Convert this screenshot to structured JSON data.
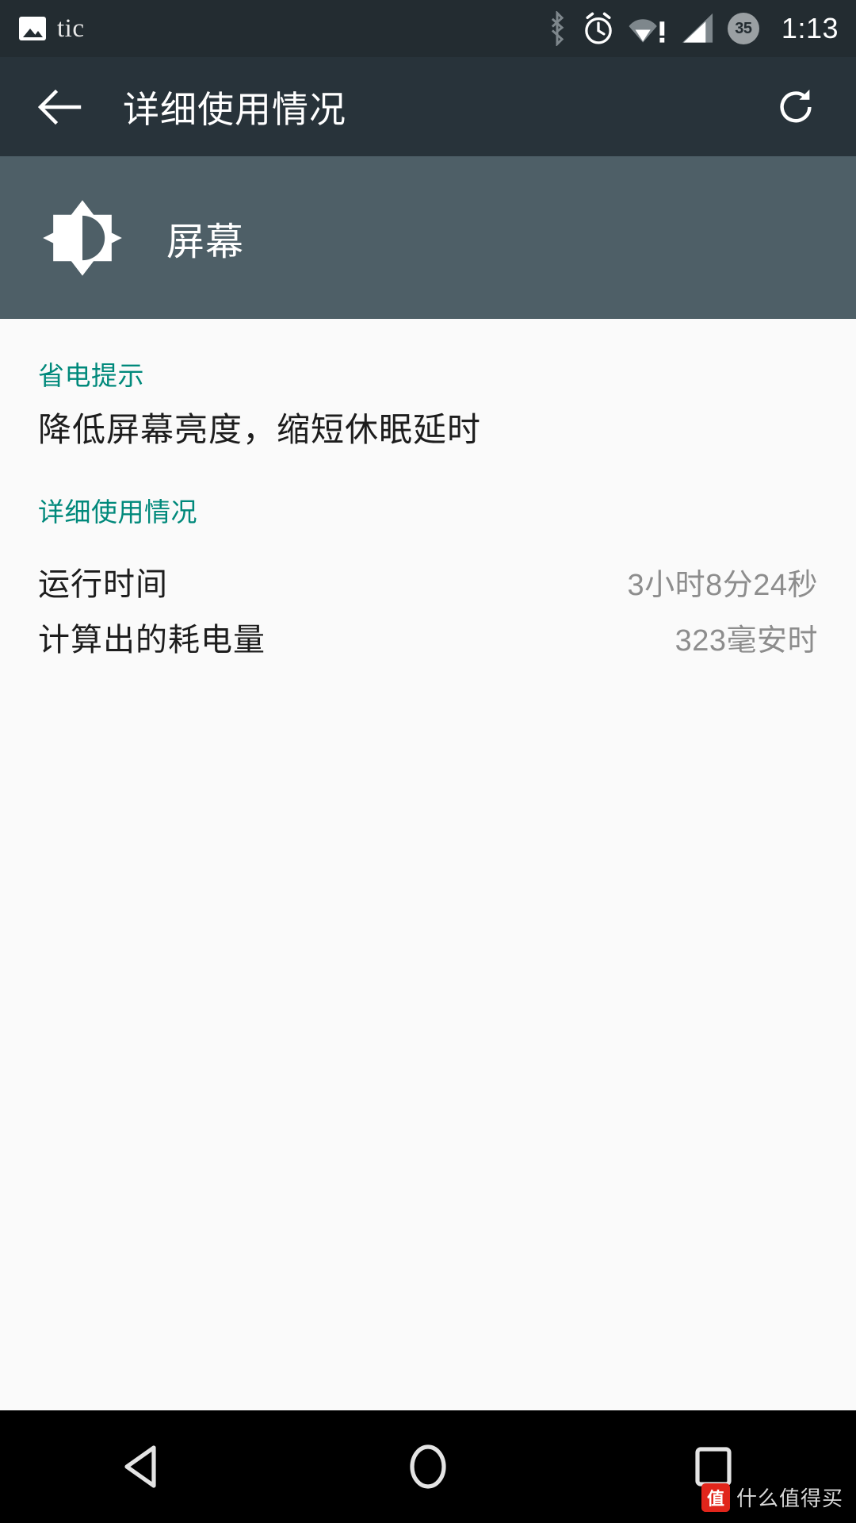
{
  "status_bar": {
    "app_name": "tic",
    "photo_icon": "photo-icon",
    "bluetooth_icon": "bluetooth-icon",
    "alarm_icon": "alarm-clock-icon",
    "wifi_icon": "wifi-no-internet-icon",
    "signal_icon": "cellular-signal-icon",
    "battery_level": "35",
    "time": "1:13"
  },
  "app_bar": {
    "back_icon": "back-arrow-icon",
    "title": "详细使用情况",
    "refresh_icon": "refresh-icon"
  },
  "sub_header": {
    "icon": "brightness-icon",
    "title": "屏幕"
  },
  "content": {
    "tip_section_label": "省电提示",
    "tip_text": "降低屏幕亮度，缩短休眠延时",
    "detail_section_label": "详细使用情况",
    "rows": [
      {
        "label": "运行时间",
        "value": "3小时8分24秒"
      },
      {
        "label": "计算出的耗电量",
        "value": "323毫安时"
      }
    ]
  },
  "nav_bar": {
    "back": "nav-back-icon",
    "home": "nav-home-icon",
    "recents": "nav-recents-icon"
  },
  "watermark": {
    "badge": "值",
    "text": "什么值得买"
  },
  "colors": {
    "status_bar_bg": "#232c31",
    "app_bar_bg": "#28333a",
    "sub_header_bg": "#4e5f67",
    "accent_teal": "#00897b",
    "content_bg": "#fafafa",
    "value_gray": "#8d8d8d",
    "watermark_red": "#e1251b"
  }
}
